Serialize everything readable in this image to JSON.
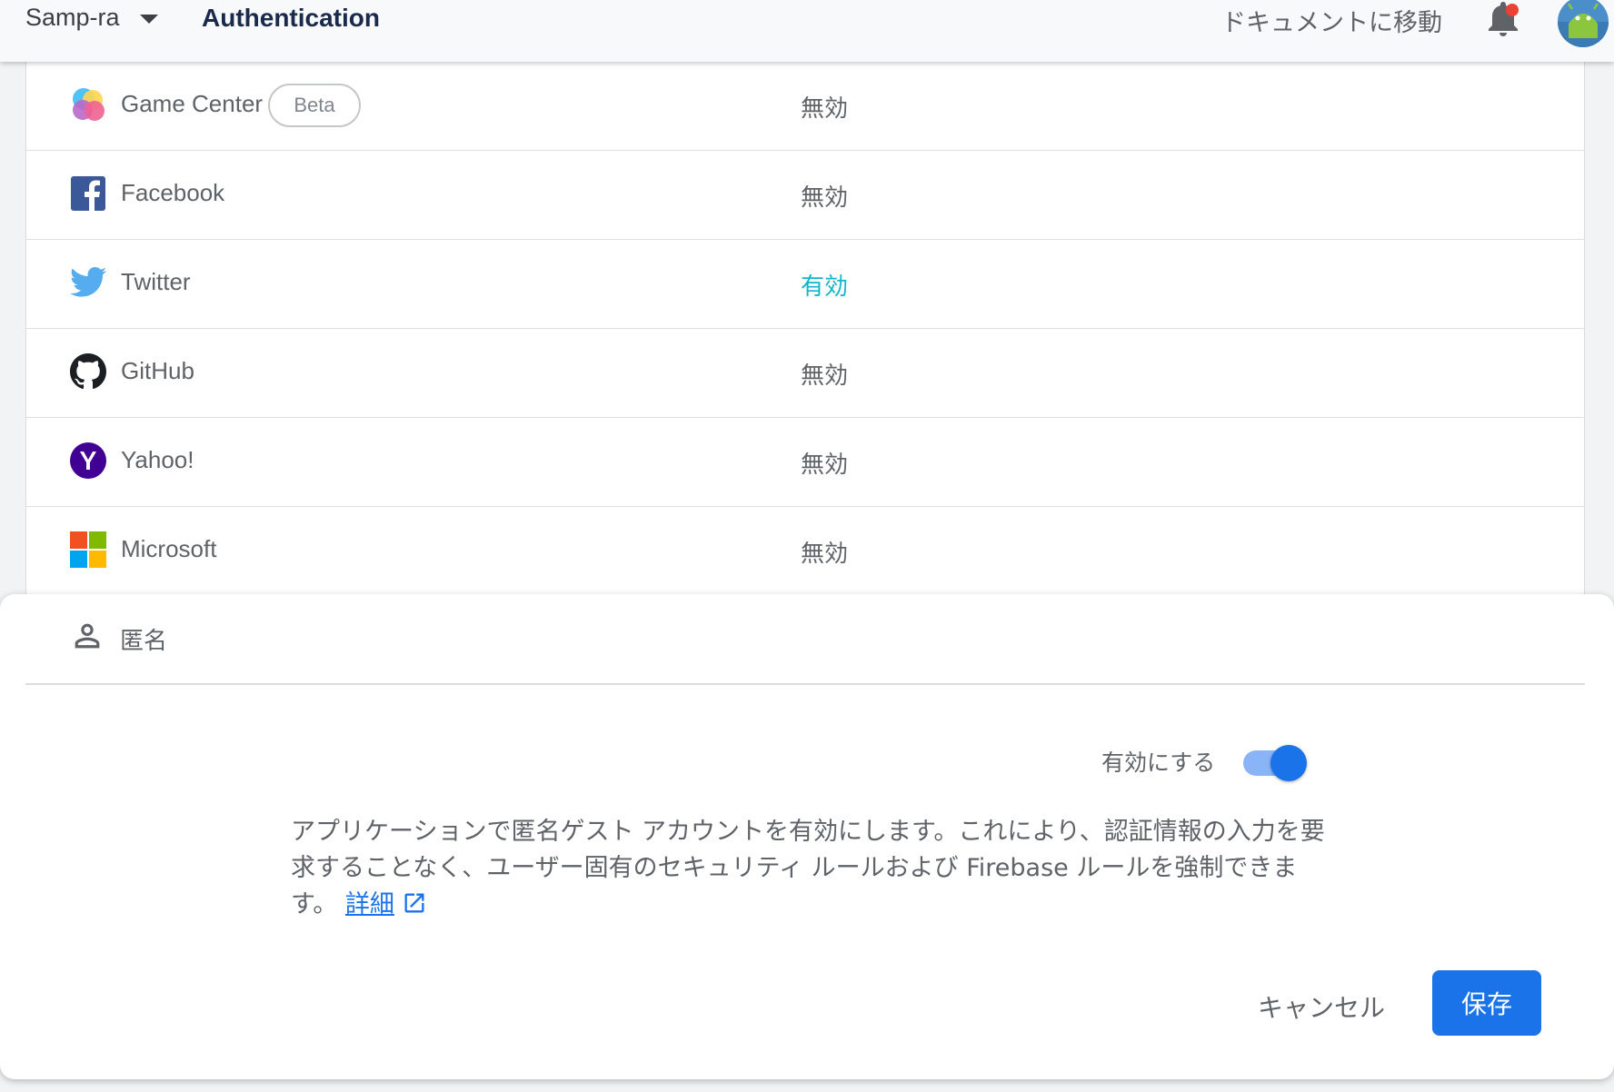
{
  "header": {
    "project_name": "Samp-ra",
    "section_title": "Authentication",
    "docs_link": "ドキュメントに移動"
  },
  "providers": [
    {
      "name": "Game Center",
      "badge": "Beta",
      "status": "無効",
      "icon": "game-center-icon"
    },
    {
      "name": "Facebook",
      "status": "無効",
      "icon": "facebook-icon"
    },
    {
      "name": "Twitter",
      "status": "有効",
      "icon": "twitter-icon"
    },
    {
      "name": "GitHub",
      "status": "無効",
      "icon": "github-icon"
    },
    {
      "name": "Yahoo!",
      "status": "無効",
      "icon": "yahoo-icon"
    },
    {
      "name": "Microsoft",
      "status": "無効",
      "icon": "microsoft-icon"
    }
  ],
  "anonymous_panel": {
    "title": "匿名",
    "icon": "person-icon",
    "toggle_label": "有効にする",
    "toggle_enabled": true,
    "description": "アプリケーションで匿名ゲスト アカウントを有効にします。これにより、認証情報の入力を要求することなく、ユーザー固有のセキュリティ ルールおよび Firebase ルールを強制できます。",
    "learn_more": "詳細",
    "cancel_label": "キャンセル",
    "save_label": "保存"
  },
  "colors": {
    "accent": "#1a73e8",
    "enabled_status": "#12b5cb",
    "notification_dot": "#ea4335"
  }
}
